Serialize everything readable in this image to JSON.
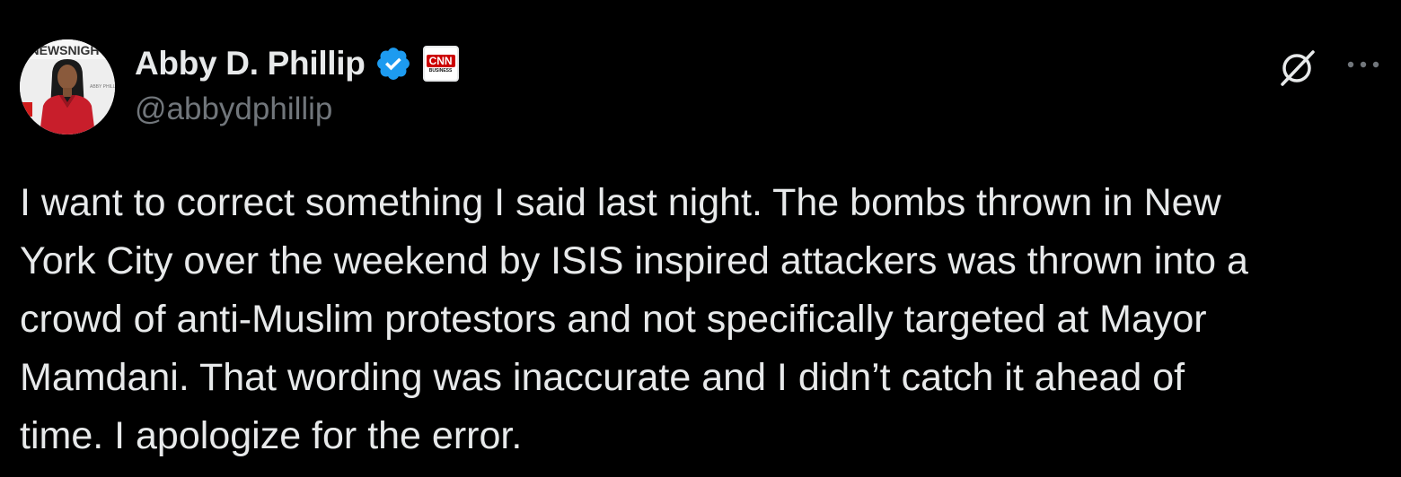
{
  "tweet": {
    "author": {
      "display_name": "Abby D. Phillip",
      "handle": "@abbydphillip",
      "avatar_banner_text": "NEWSNIGH",
      "verified_icon": "verified-badge-icon",
      "affiliation_logo": "CNN",
      "affiliation_sub": "BUSINESS"
    },
    "actions": {
      "grok_icon": "grok-slash-circle-icon",
      "more_icon": "more-dots-icon"
    },
    "text": "I want to correct something I said last night. The bombs thrown in New\nYork City over the weekend by ISIS inspired attackers was thrown into a\ncrowd of anti-Muslim protestors and not specifically targeted at Mayor\nMamdani. That wording was inaccurate and I didn’t catch it ahead of\ntime. I apologize for the error."
  },
  "colors": {
    "background": "#000000",
    "text_primary": "#e7e9ea",
    "text_secondary": "#71767b",
    "verified_blue": "#1d9bf0",
    "cnn_red": "#cc0000"
  }
}
